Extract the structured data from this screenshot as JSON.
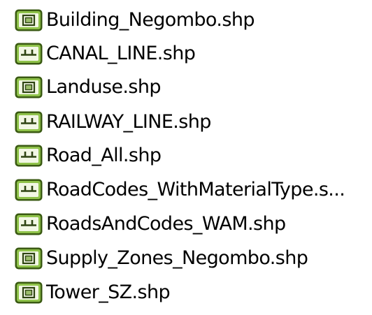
{
  "colors": {
    "icon_frame_outer": "#3a5a12",
    "icon_frame_inner": "#8fc24a",
    "icon_fill": "#f2f7e4",
    "icon_glyph": "#2e4412",
    "text": "#000000"
  },
  "files": [
    {
      "label": "Building_Negombo.shp",
      "icon": "polygon-layer-icon"
    },
    {
      "label": "CANAL_LINE.shp",
      "icon": "line-layer-icon"
    },
    {
      "label": "Landuse.shp",
      "icon": "polygon-layer-icon"
    },
    {
      "label": "RAILWAY_LINE.shp",
      "icon": "line-layer-icon"
    },
    {
      "label": "Road_All.shp",
      "icon": "line-layer-icon"
    },
    {
      "label": "RoadCodes_WithMaterialType.s...",
      "icon": "line-layer-icon"
    },
    {
      "label": "RoadsAndCodes_WAM.shp",
      "icon": "line-layer-icon"
    },
    {
      "label": "Supply_Zones_Negombo.shp",
      "icon": "polygon-layer-icon"
    },
    {
      "label": "Tower_SZ.shp",
      "icon": "polygon-layer-icon"
    }
  ]
}
